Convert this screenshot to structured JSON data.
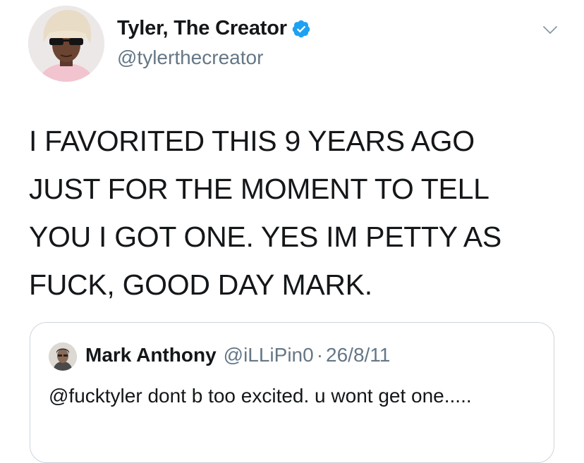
{
  "tweet": {
    "display_name": "Tyler, The Creator",
    "handle": "@tylerthecreator",
    "verified": true,
    "text": "I FAVORITED THIS 9 YEARS AGO JUST FOR THE MOMENT TO TELL YOU I GOT ONE. YES IM PETTY AS FUCK, GOOD DAY MARK."
  },
  "quoted_tweet": {
    "display_name": "Mark Anthony",
    "handle": "@iLLiPin0",
    "separator": "·",
    "date": "26/8/11",
    "text": "@fucktyler dont b too excited. u wont get one....."
  },
  "icons": {
    "verified": "verified-badge-icon",
    "menu": "chevron-down-icon"
  },
  "colors": {
    "verified_blue": "#1da1f2",
    "secondary_text": "#657786",
    "primary_text": "#14171a",
    "border": "#ccd6dd"
  }
}
